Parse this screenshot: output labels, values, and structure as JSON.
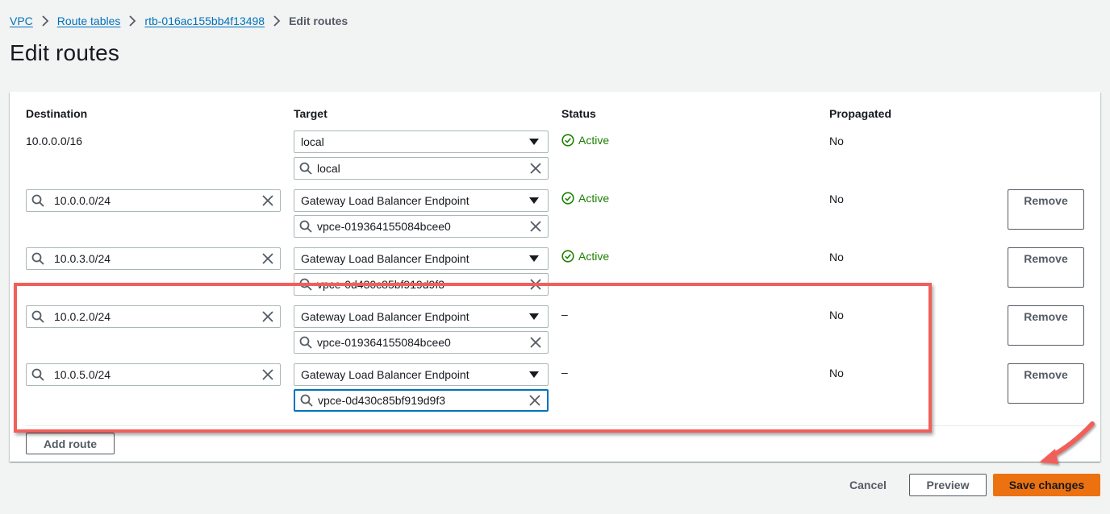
{
  "breadcrumb": {
    "items": [
      {
        "label": "VPC"
      },
      {
        "label": "Route tables"
      },
      {
        "label": "rtb-016ac155bb4f13498"
      }
    ],
    "current": "Edit routes"
  },
  "page_title": "Edit routes",
  "table": {
    "headers": {
      "destination": "Destination",
      "target": "Target",
      "status": "Status",
      "propagated": "Propagated"
    },
    "rows": [
      {
        "destination": "10.0.0.0/16",
        "target_type": "local",
        "target_value": "local",
        "status": "Active",
        "propagated": "No"
      },
      {
        "destination": "10.0.0.0/24",
        "target_type": "Gateway Load Balancer Endpoint",
        "target_value": "vpce-019364155084bcee0",
        "status": "Active",
        "propagated": "No",
        "remove_label": "Remove"
      },
      {
        "destination": "10.0.3.0/24",
        "target_type": "Gateway Load Balancer Endpoint",
        "target_value": "vpce-0d430c85bf919d9f3",
        "status": "Active",
        "propagated": "No",
        "remove_label": "Remove"
      },
      {
        "destination": "10.0.2.0/24",
        "target_type": "Gateway Load Balancer Endpoint",
        "target_value": "vpce-019364155084bcee0",
        "status": "–",
        "propagated": "No",
        "remove_label": "Remove"
      },
      {
        "destination": "10.0.5.0/24",
        "target_type": "Gateway Load Balancer Endpoint",
        "target_value": "vpce-0d430c85bf919d9f3",
        "status": "–",
        "propagated": "No",
        "remove_label": "Remove"
      }
    ]
  },
  "add_route_label": "Add route",
  "footer": {
    "cancel_label": "Cancel",
    "preview_label": "Preview",
    "save_label": "Save changes"
  },
  "colors": {
    "link": "#0073bb",
    "status_active": "#1d8102",
    "primary_button": "#ec7211",
    "annotation": "#f0605a"
  },
  "icons": [
    "chevron-right-icon",
    "search-icon",
    "clear-icon",
    "caret-down-icon",
    "check-circle-icon"
  ]
}
